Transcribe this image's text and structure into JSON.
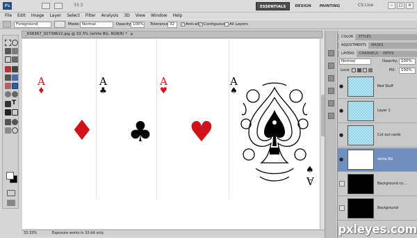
{
  "app": {
    "logo": "Ps",
    "zoom_menu": "33.3",
    "cs_live": "CS Live"
  },
  "workspaces": [
    {
      "label": "ESSENTIALS",
      "active": true
    },
    {
      "label": "DESIGN",
      "active": false
    },
    {
      "label": "PAINTING",
      "active": false
    }
  ],
  "menus": [
    "File",
    "Edit",
    "Image",
    "Layer",
    "Select",
    "Filter",
    "Analysis",
    "3D",
    "View",
    "Window",
    "Help"
  ],
  "options": {
    "fill": "Foreground",
    "mode_label": "Mode:",
    "mode_value": "Normal",
    "opacity_label": "Opacity:",
    "opacity_value": "100%",
    "tolerance_label": "Tolerance:",
    "tolerance_value": "32",
    "antialias": "Anti-alias",
    "contiguous": "Contiguous",
    "all_layers": "All Layers"
  },
  "document": {
    "tab_title": "_838367_92738622.jpg @ 33.3% (white BG, RGB/8) *",
    "zoom": "33.33%",
    "status": "Exposure works in 32-bit only"
  },
  "cards": [
    {
      "rank": "A",
      "suit": "♦",
      "color": "#d0121a"
    },
    {
      "rank": "A",
      "suit": "♣",
      "color": "#000000"
    },
    {
      "rank": "A",
      "suit": "♥",
      "color": "#d0121a"
    },
    {
      "rank": "A",
      "suit": "♠",
      "color": "#000000"
    }
  ],
  "panels": {
    "top_tabs": [
      "COLOR",
      "STYLES"
    ],
    "mid_tabs": [
      "ADJUSTMENTS",
      "MASKS"
    ],
    "layer_tabs": [
      "LAYERS",
      "CHANNELS",
      "PATHS"
    ],
    "blend_mode": "Normal",
    "opacity_label": "Opacity:",
    "opacity_value": "100%",
    "lock_label": "Lock:",
    "fill_label": "Fill:",
    "fill_value": "100%"
  },
  "layers": [
    {
      "name": "Red Stuff",
      "thumb": "checker",
      "selected": false,
      "visible": true
    },
    {
      "name": "Layer 1",
      "thumb": "checker",
      "selected": false,
      "visible": true
    },
    {
      "name": "Cut out cards",
      "thumb": "checker",
      "selected": false,
      "visible": true
    },
    {
      "name": "white BG",
      "thumb": "white",
      "selected": true,
      "visible": true
    },
    {
      "name": "Background co...",
      "thumb": "black",
      "selected": false,
      "visible": false
    },
    {
      "name": "Background",
      "thumb": "black",
      "selected": false,
      "visible": false
    }
  ],
  "watermark": "pxleyes.com"
}
